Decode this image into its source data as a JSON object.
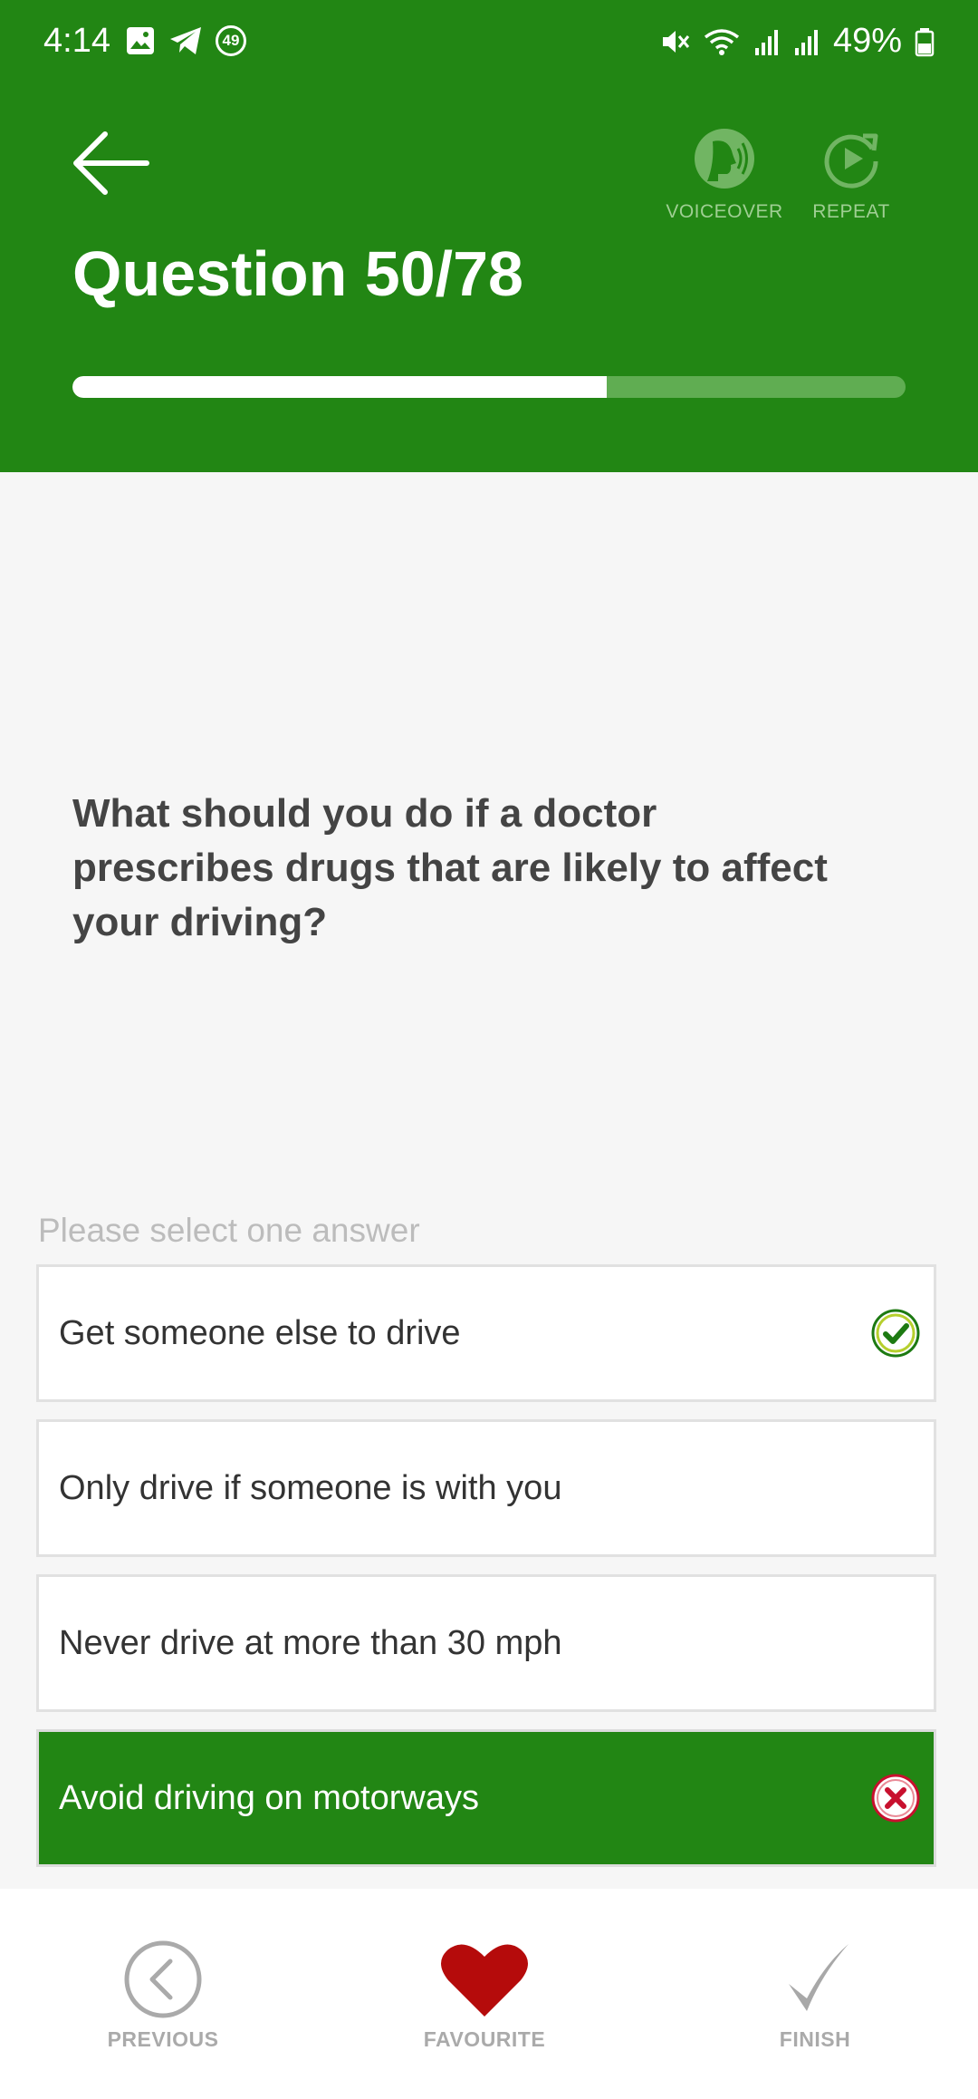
{
  "status_bar": {
    "time": "4:14",
    "notification_count": "49",
    "battery": "49%"
  },
  "header": {
    "title": "Question 50/78",
    "voiceover_label": "VOICEOVER",
    "repeat_label": "REPEAT",
    "progress": {
      "current": 50,
      "total": 78
    }
  },
  "question": {
    "text": "What should you do if a doctor prescribes drugs that are likely to affect your driving?"
  },
  "answers": {
    "hint": "Please select one answer",
    "items": [
      {
        "label": "Get someone else to drive",
        "state": "correct"
      },
      {
        "label": "Only drive if someone is with you",
        "state": "none"
      },
      {
        "label": "Never drive at more than 30 mph",
        "state": "none"
      },
      {
        "label": "Avoid driving on motorways",
        "state": "selected-wrong"
      }
    ]
  },
  "bottom_nav": {
    "previous": "PREVIOUS",
    "favourite": "FAVOURITE",
    "finish": "FINISH"
  },
  "colors": {
    "primary_green": "#228614",
    "favourite_red": "#b50b0b",
    "wrong_red": "#c8102e"
  }
}
